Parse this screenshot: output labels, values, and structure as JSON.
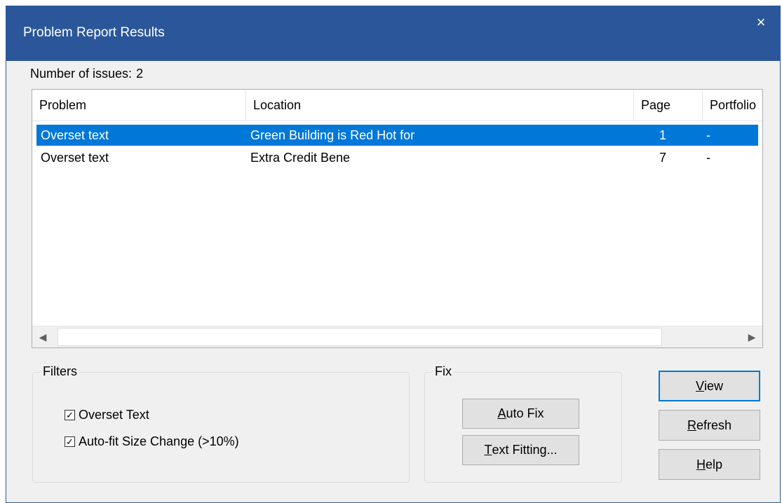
{
  "window": {
    "title": "Problem Report Results",
    "close_glyph": "×"
  },
  "summary": {
    "label": "Number of issues:",
    "count": "2"
  },
  "table": {
    "columns": [
      "Problem",
      "Location",
      "Page",
      "Portfolio"
    ],
    "rows": [
      {
        "problem": "Overset text",
        "location": "Green Building is Red Hot for",
        "page": "1",
        "portfolio": "-",
        "selected": true
      },
      {
        "problem": "Overset text",
        "location": "Extra Credit Bene",
        "page": "7",
        "portfolio": "-",
        "selected": false
      }
    ]
  },
  "scrollbar": {
    "left_arrow": "◀",
    "right_arrow": "▶"
  },
  "filters": {
    "label": "Filters",
    "items": [
      {
        "label": "Overset Text",
        "checked": true
      },
      {
        "label": "Auto-fit Size Change (>10%)",
        "checked": true
      }
    ]
  },
  "fix": {
    "label": "Fix",
    "auto_fix": {
      "mnemonic": "A",
      "rest": "uto Fix"
    },
    "text_fitting": {
      "mnemonic": "T",
      "rest": "ext Fitting..."
    }
  },
  "actions": {
    "view": {
      "mnemonic": "V",
      "rest": "iew"
    },
    "refresh": {
      "mnemonic": "R",
      "rest": "efresh"
    },
    "help": {
      "mnemonic": "H",
      "rest": "elp"
    }
  },
  "colors": {
    "titlebar": "#2b579a",
    "selection": "#0078d7",
    "dialog_bg": "#f0f0f0"
  },
  "check_glyph": "✓"
}
